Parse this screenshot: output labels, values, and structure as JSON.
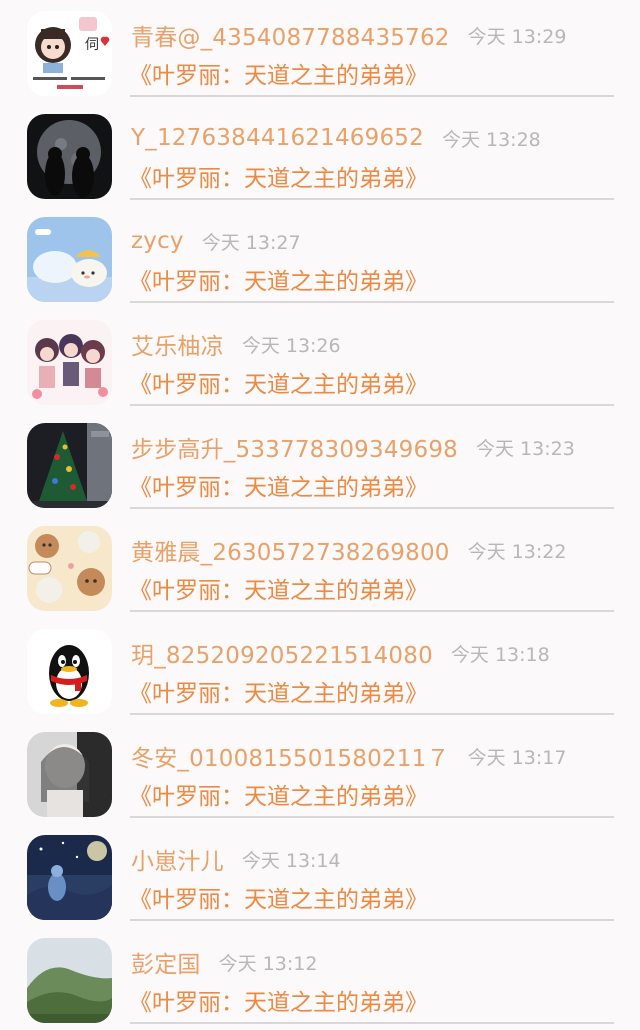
{
  "items": [
    {
      "username": "青春@_4354087788435762",
      "time": "今天 13:29",
      "book": "《叶罗丽：天道之主的弟弟》",
      "avatar": "cartoon-girl-avatar"
    },
    {
      "username": "Y_127638441621469652",
      "time": "今天 13:28",
      "book": "《叶罗丽：天道之主的弟弟》",
      "avatar": "moon-couple-silhouette-avatar"
    },
    {
      "username": "zycy",
      "time": "今天 13:27",
      "book": "《叶罗丽：天道之主的弟弟》",
      "avatar": "clouds-avatar"
    },
    {
      "username": "艾乐柚凉",
      "time": "今天 13:26",
      "book": "《叶罗丽：天道之主的弟弟》",
      "avatar": "anime-group-avatar"
    },
    {
      "username": "步步高升_533778309349698",
      "time": "今天 13:23",
      "book": "《叶罗丽：天道之主的弟弟》",
      "avatar": "christmas-tree-avatar"
    },
    {
      "username": "黄雅晨_2630572738269800",
      "time": "今天 13:22",
      "book": "《叶罗丽：天道之主的弟弟》",
      "avatar": "bear-pattern-avatar"
    },
    {
      "username": "玥_825209205221514080",
      "time": "今天 13:18",
      "book": "《叶罗丽：天道之主的弟弟》",
      "avatar": "penguin-avatar"
    },
    {
      "username": "冬安_0100815501580211７",
      "time": "今天 13:17",
      "book": "《叶罗丽：天道之主的弟弟》",
      "avatar": "person-photo-avatar"
    },
    {
      "username": "小崽汁儿",
      "time": "今天 13:14",
      "book": "《叶罗丽：天道之主的弟弟》",
      "avatar": "night-sky-avatar"
    },
    {
      "username": "彭定国",
      "time": "今天 13:12",
      "book": "《叶罗丽：天道之主的弟弟》",
      "avatar": "mountain-avatar"
    }
  ]
}
